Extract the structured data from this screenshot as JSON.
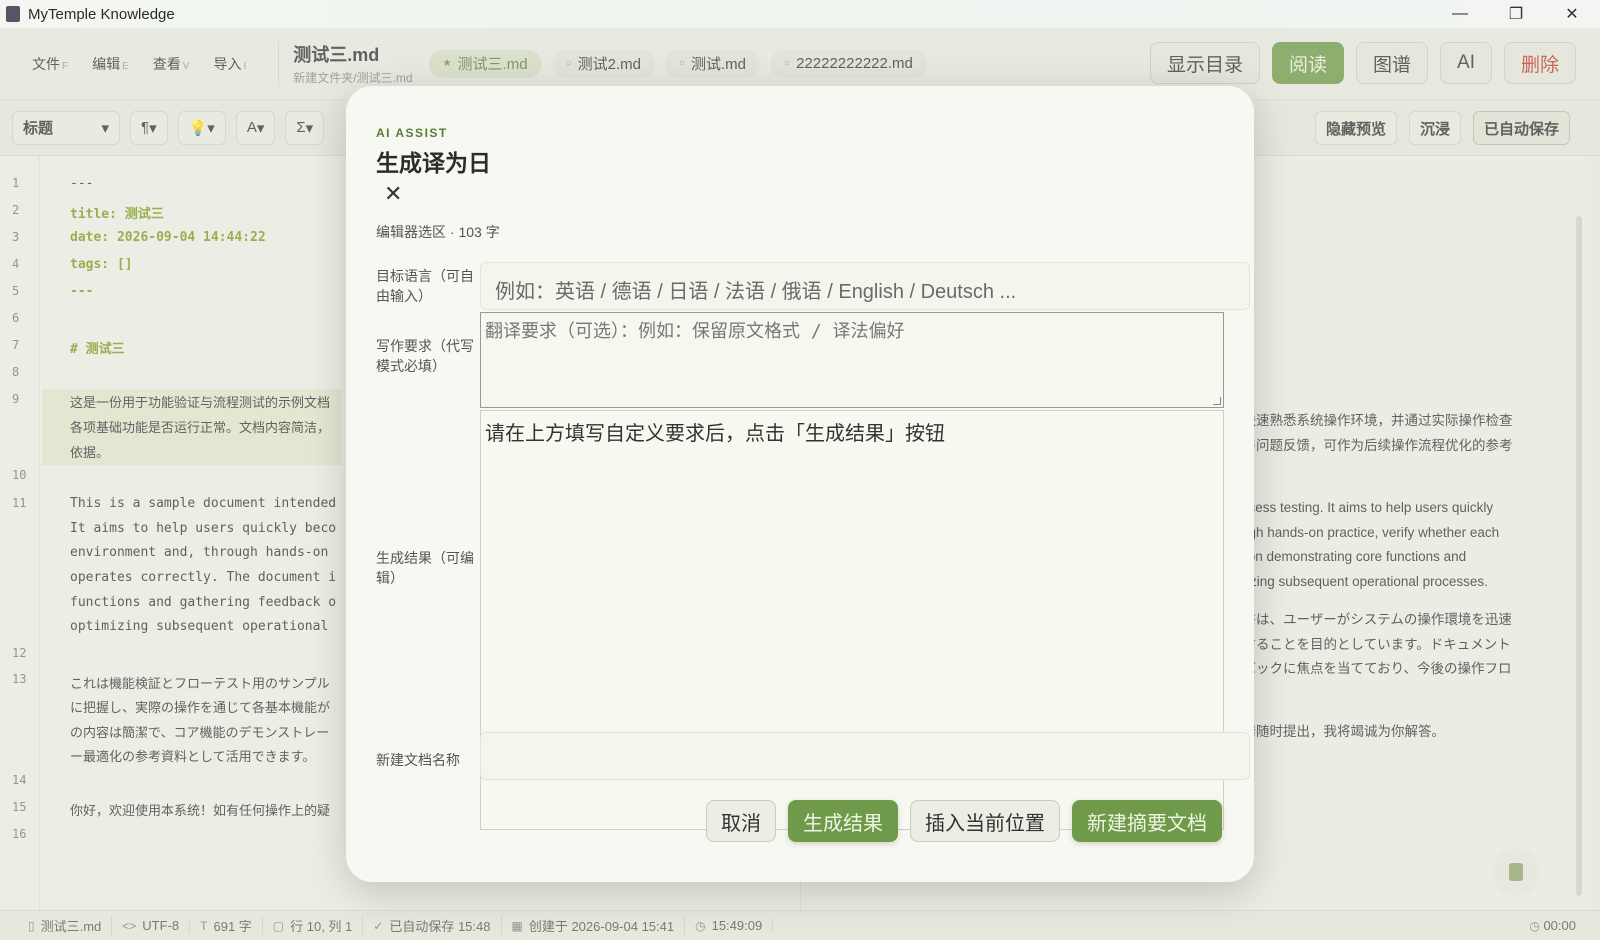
{
  "app": {
    "title": "MyTemple Knowledge"
  },
  "window_controls": {
    "minimize": "—",
    "restore": "❐",
    "close": "✕"
  },
  "menu": [
    {
      "label": "文件",
      "key": "F"
    },
    {
      "label": "编辑",
      "key": "E"
    },
    {
      "label": "查看",
      "key": "V"
    },
    {
      "label": "导入",
      "key": "I"
    }
  ],
  "document": {
    "title": "测试三.md",
    "path": "新建文件夹/测试三.md"
  },
  "tabs": [
    {
      "label": "测试三.md",
      "marker": "★"
    },
    {
      "label": "测试2.md",
      "marker": "○"
    },
    {
      "label": "测试.md",
      "marker": "○"
    },
    {
      "label": "22222222222.md",
      "marker": "○"
    }
  ],
  "header_buttons": {
    "toc": "显示目录",
    "read": "阅读",
    "graph": "图谱",
    "ai": "AI",
    "delete": "删除"
  },
  "toolbar": {
    "heading": "标题",
    "paragraph": "¶",
    "bulb": "💡",
    "font": "A",
    "sigma": "Σ",
    "hide_preview": "隐藏预览",
    "immersive": "沉浸",
    "autosaved": "已自动保存"
  },
  "editor": {
    "line_numbers": [
      "1",
      "2",
      "3",
      "4",
      "5",
      "6",
      "7",
      "8",
      "9",
      "10",
      "11",
      "12",
      "13",
      "14",
      "15",
      "16"
    ],
    "lines": {
      "l1": "---",
      "l2": "title: 测试三",
      "l3": "date: 2026-09-04 14:44:22",
      "l4": "tags: []",
      "l5": "---",
      "l7": "# 测试三",
      "l9a": "这是一份用于功能验证与流程测试的示例文档",
      "l9b": "各项基础功能是否运行正常。文档内容简洁，",
      "l9c": "依据。",
      "l11a": "This is a sample document intended",
      "l11b": "It aims to help users quickly beco",
      "l11c": "environment and, through hands-on",
      "l11d": "operates correctly. The document i",
      "l11e": "functions and gathering feedback o",
      "l11f": "optimizing subsequent operational",
      "l13a": "これは機能検証とフローテスト用のサンプル",
      "l13b": "に把握し、実際の操作を通じて各基本機能が",
      "l13c": "の内容は簡潔で、コア機能のデモンストレー",
      "l13d": "ー最適化の参考資料として活用できます。",
      "l15": "你好，欢迎使用本系统！如有任何操作上的疑"
    }
  },
  "preview": {
    "p1a": "户快速熟悉系统操作环境，并通过实际操作检查",
    "p1b": "示与问题反馈，可作为后续操作流程优化的参考",
    "p2a": "process testing. It aims to help users quickly",
    "p2b": "rough hands-on practice, verify whether each",
    "p2c": "ng on demonstrating core functions and",
    "p2d": "timizing subsequent operational processes.",
    "p3a": "本書は、ユーザーがシステムの操作環境を迅速",
    "p3b": "認することを目的としています。ドキュメント",
    "p3c": "ドバックに焦点を当てており、今後の操作フロ",
    "p4": "，请随时提出，我将竭诚为你解答。"
  },
  "modal": {
    "kicker": "AI ASSIST",
    "title": "生成译为日",
    "close": "✕",
    "selection_info": "编辑器选区 · 103 字",
    "target_lang_label": "目标语言（可自由输入）",
    "target_lang_placeholder": "例如：英语 / 德语 / 日语 / 法语 / 俄语 / English / Deutsch ...",
    "requirements_label": "写作要求（代写模式必填）",
    "requirements_placeholder": "翻译要求（可选）：例如：保留原文格式 / 译法偏好",
    "result_label": "生成结果（可编辑）",
    "result_text": "请在上方填写自定义要求后，点击「生成结果」按钮",
    "new_doc_label": "新建文档名称",
    "new_doc_value": "",
    "buttons": {
      "cancel": "取消",
      "generate": "生成结果",
      "insert": "插入当前位置",
      "new_summary": "新建摘要文档"
    }
  },
  "statusbar": {
    "file": "测试三.md",
    "encoding": "UTF-8",
    "chars": "691 字",
    "cursor": "行 10, 列 1",
    "autosave": "已自动保存 15:48",
    "created": "创建于 2026-09-04 15:41",
    "clock": "15:49:09",
    "timer": "00:00"
  }
}
